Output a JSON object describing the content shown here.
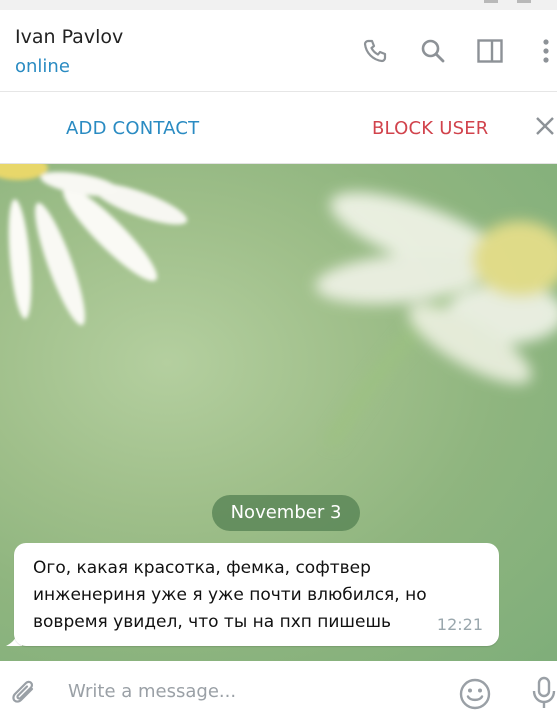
{
  "header": {
    "name": "Ivan Pavlov",
    "status": "online",
    "icons": [
      "phone-icon",
      "search-icon",
      "sidebar-toggle-icon",
      "more-vertical-icon"
    ]
  },
  "actions": {
    "add_contact": "ADD CONTACT",
    "block_user": "BLOCK USER",
    "close_icon": "close-icon"
  },
  "chat": {
    "date_separator": "November 3",
    "messages": [
      {
        "text": "Ого, какая красотка, фемка, софтвер инженериня уже я уже почти влюбился, но вовремя увидел, что ты на пхп пишешь",
        "time": "12:21"
      }
    ]
  },
  "composer": {
    "placeholder": "Write a message...",
    "icons": [
      "attach-icon",
      "emoji-icon",
      "microphone-icon"
    ]
  },
  "colors": {
    "accent": "#2a8bc2",
    "danger": "#d1434c",
    "date_pill": "#5c8758"
  }
}
